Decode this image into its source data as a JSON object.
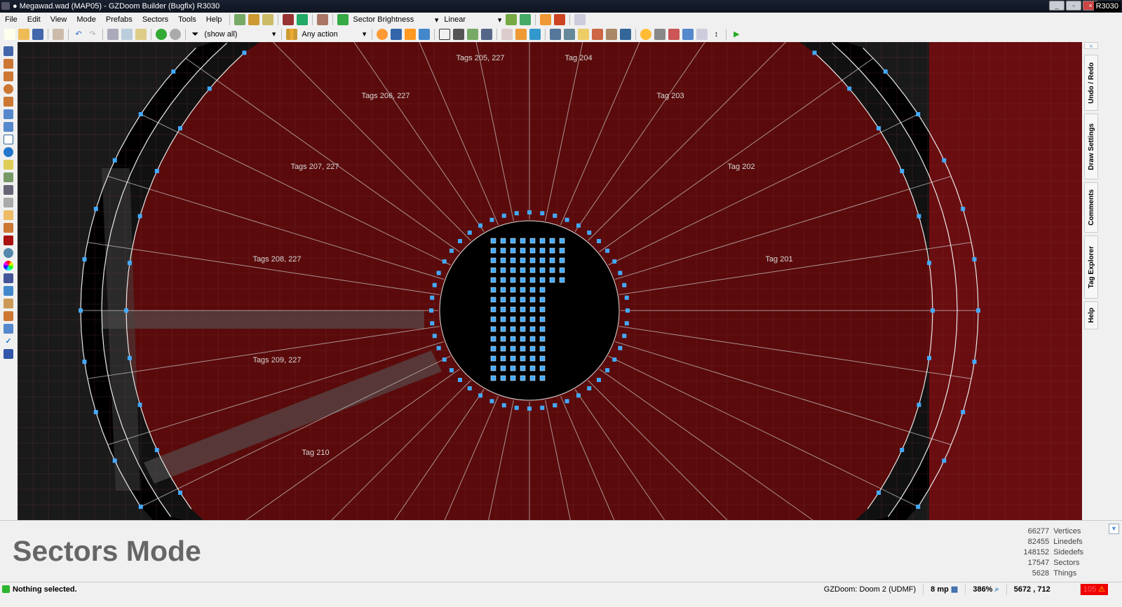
{
  "window": {
    "title": "● Megawad.wad (MAP05) - GZDoom Builder (Bugfix) R3030",
    "revision": "R3030"
  },
  "menu": [
    "File",
    "Edit",
    "View",
    "Mode",
    "Prefabs",
    "Sectors",
    "Tools",
    "Help"
  ],
  "toolbar": {
    "view_mode": "Sector Brightness",
    "interpolation": "Linear",
    "filter": "(show all)",
    "action_filter": "Any action"
  },
  "map": {
    "labels": [
      "Tags 205, 227",
      "Tag 204",
      "Tags 206, 227",
      "Tag 203",
      "Tags 207, 227",
      "Tag 202",
      "Tags 208, 227",
      "Tag 201",
      "Tags 209, 227",
      "Tag 210"
    ],
    "colors": {
      "floor": "#5a0a0a",
      "vertex": "#44aaff",
      "line": "#e8e8e8",
      "grid": "#7a3a3a"
    }
  },
  "right_tabs": [
    "Undo / Redo",
    "Draw Settings",
    "Comments",
    "Tag Explorer",
    "Help"
  ],
  "info": {
    "mode_title": "Sectors Mode",
    "stats": [
      {
        "value": "66277",
        "label": "Vertices"
      },
      {
        "value": "82455",
        "label": "Linedefs"
      },
      {
        "value": "148152",
        "label": "Sidedefs"
      },
      {
        "value": "17547",
        "label": "Sectors"
      },
      {
        "value": "5628",
        "label": "Things"
      }
    ]
  },
  "status": {
    "message": "Nothing selected.",
    "game_config": "GZDoom: Doom 2 (UDMF)",
    "grid": "8 mp",
    "zoom": "386%",
    "coordinates": "5672 , 712",
    "warnings": "105",
    "status_color": "#2db52d",
    "warning_color": "#ee0000"
  }
}
